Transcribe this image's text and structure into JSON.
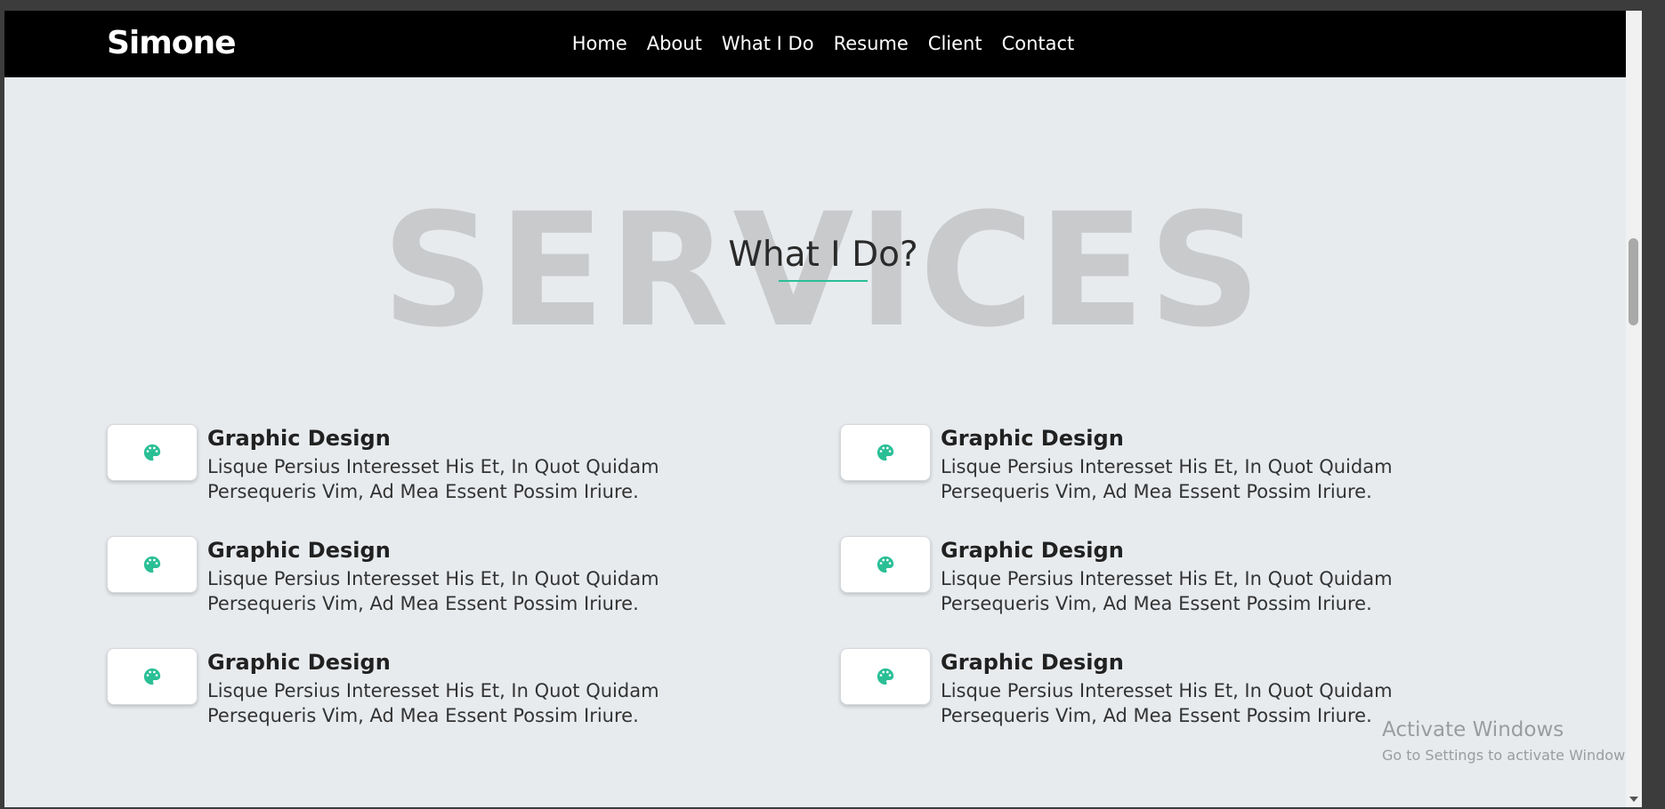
{
  "brand": "Simone",
  "nav": [
    "Home",
    "About",
    "What I Do",
    "Resume",
    "Client",
    "Contact"
  ],
  "section": {
    "background_word": "SERVICES",
    "heading": "What I Do?",
    "accent_color": "#2bbf96"
  },
  "services": [
    {
      "icon": "palette-icon",
      "title": "Graphic Design",
      "desc_line1": "Lisque Persius Interesset His Et, In Quot Quidam",
      "desc_line2": "Persequeris Vim, Ad Mea Essent Possim Iriure."
    },
    {
      "icon": "palette-icon",
      "title": "Graphic Design",
      "desc_line1": "Lisque Persius Interesset His Et, In Quot Quidam",
      "desc_line2": "Persequeris Vim, Ad Mea Essent Possim Iriure."
    },
    {
      "icon": "palette-icon",
      "title": "Graphic Design",
      "desc_line1": "Lisque Persius Interesset His Et, In Quot Quidam",
      "desc_line2": "Persequeris Vim, Ad Mea Essent Possim Iriure."
    },
    {
      "icon": "palette-icon",
      "title": "Graphic Design",
      "desc_line1": "Lisque Persius Interesset His Et, In Quot Quidam",
      "desc_line2": "Persequeris Vim, Ad Mea Essent Possim Iriure."
    },
    {
      "icon": "palette-icon",
      "title": "Graphic Design",
      "desc_line1": "Lisque Persius Interesset His Et, In Quot Quidam",
      "desc_line2": "Persequeris Vim, Ad Mea Essent Possim Iriure."
    },
    {
      "icon": "palette-icon",
      "title": "Graphic Design",
      "desc_line1": "Lisque Persius Interesset His Et, In Quot Quidam",
      "desc_line2": "Persequeris Vim, Ad Mea Essent Possim Iriure."
    }
  ],
  "watermark": {
    "line1": "Activate Windows",
    "line2": "Go to Settings to activate Windows."
  }
}
